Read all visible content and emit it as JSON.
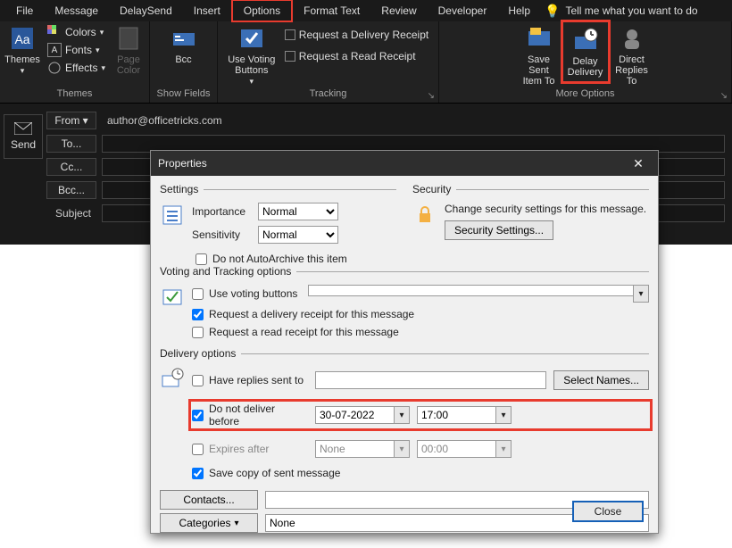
{
  "menubar": {
    "items": [
      "File",
      "Message",
      "DelaySend",
      "Insert",
      "Options",
      "Format Text",
      "Review",
      "Developer",
      "Help"
    ],
    "highlighted_index": 4,
    "tell_me": "Tell me what you want to do"
  },
  "ribbon": {
    "groups": {
      "themes": {
        "label": "Themes",
        "themes_btn": "Themes",
        "colors": "Colors",
        "fonts": "Fonts",
        "effects": "Effects",
        "page_color": "Page Color"
      },
      "show_fields": {
        "label": "Show Fields",
        "bcc": "Bcc"
      },
      "tracking": {
        "label": "Tracking",
        "voting": "Use Voting Buttons",
        "delivery_receipt": "Request a Delivery Receipt",
        "read_receipt": "Request a Read Receipt"
      },
      "more_options": {
        "label": "More Options",
        "save_sent": "Save Sent Item To",
        "delay_delivery": "Delay Delivery",
        "direct_replies": "Direct Replies To"
      }
    }
  },
  "compose": {
    "send": "Send",
    "from_btn": "From ▾",
    "from_value": "author@officetricks.com",
    "to": "To...",
    "cc": "Cc...",
    "bcc": "Bcc...",
    "subject_label": "Subject"
  },
  "dialog": {
    "title": "Properties",
    "settings_legend": "Settings",
    "importance_label": "Importance",
    "importance_value": "Normal",
    "sensitivity_label": "Sensitivity",
    "sensitivity_value": "Normal",
    "autoarchive": "Do not AutoArchive this item",
    "security_legend": "Security",
    "security_text": "Change security settings for this message.",
    "security_btn": "Security Settings...",
    "voting_legend": "Voting and Tracking options",
    "use_voting": "Use voting buttons",
    "req_delivery": "Request a delivery receipt for this message",
    "req_read": "Request a read receipt for this message",
    "delivery_legend": "Delivery options",
    "have_replies": "Have replies sent to",
    "select_names": "Select Names...",
    "do_not_deliver": "Do not deliver before",
    "dnd_date": "30-07-2022",
    "dnd_time": "17:00",
    "expires_after": "Expires after",
    "expires_date": "None",
    "expires_time": "00:00",
    "save_copy": "Save copy of sent message",
    "contacts_btn": "Contacts...",
    "categories_btn": "Categories",
    "categories_value": "None",
    "close": "Close"
  },
  "checked": {
    "autoarchive": false,
    "use_voting": false,
    "req_delivery": true,
    "req_read": false,
    "have_replies": false,
    "do_not_deliver": true,
    "expires_after": false,
    "save_copy": true
  }
}
